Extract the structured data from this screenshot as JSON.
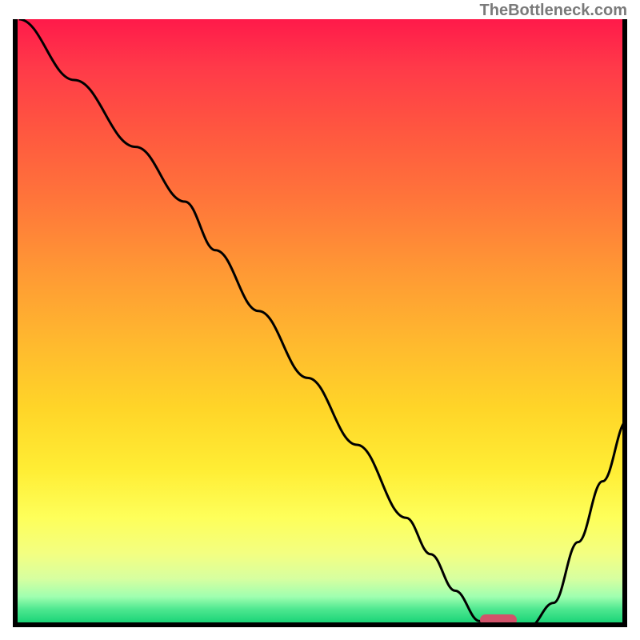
{
  "watermark": "TheBottleneck.com",
  "chart_data": {
    "type": "line",
    "title": "",
    "xlabel": "",
    "ylabel": "",
    "xlim": [
      0,
      100
    ],
    "ylim": [
      0,
      100
    ],
    "x": [
      1,
      10,
      20,
      28,
      33,
      40,
      48,
      56,
      64,
      68,
      72,
      76,
      80,
      84,
      88,
      92,
      96,
      100
    ],
    "values": [
      100,
      90,
      79,
      70,
      62,
      52,
      41,
      30,
      18,
      12,
      6,
      1,
      0,
      0,
      4,
      14,
      24,
      34
    ],
    "marker": {
      "x_start": 76,
      "x_end": 82,
      "y": 0
    }
  },
  "colors": {
    "curve": "#000000",
    "marker": "#d2536a",
    "frame": "#000000"
  }
}
